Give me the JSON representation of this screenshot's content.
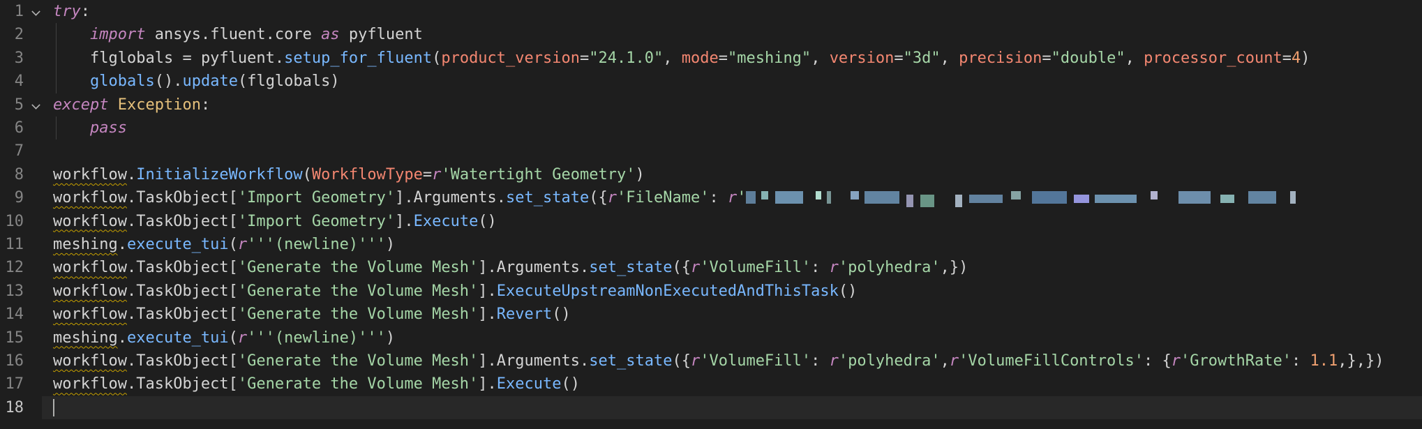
{
  "editor": {
    "language": "python",
    "current_line": 18,
    "redacted_note": "",
    "lines": [
      {
        "n": "1",
        "tokens": [
          [
            "ctrl",
            "try"
          ],
          [
            "plain",
            ":"
          ]
        ],
        "fold": true
      },
      {
        "n": "2",
        "indent": 1,
        "tokens": [
          [
            "ctrl",
            "import"
          ],
          [
            "plain",
            " ansys.fluent.core "
          ],
          [
            "ctrl",
            "as"
          ],
          [
            "plain",
            " pyfluent"
          ]
        ]
      },
      {
        "n": "3",
        "indent": 1,
        "tokens": [
          [
            "plain",
            "flglobals = pyfluent."
          ],
          [
            "meth",
            "setup_for_fluent"
          ],
          [
            "plain",
            "("
          ],
          [
            "param",
            "product_version"
          ],
          [
            "plain",
            "="
          ],
          [
            "strg",
            "\"24.1.0\""
          ],
          [
            "plain",
            ", "
          ],
          [
            "param",
            "mode"
          ],
          [
            "plain",
            "="
          ],
          [
            "strg",
            "\"meshing\""
          ],
          [
            "plain",
            ", "
          ],
          [
            "param",
            "version"
          ],
          [
            "plain",
            "="
          ],
          [
            "strg",
            "\"3d\""
          ],
          [
            "plain",
            ", "
          ],
          [
            "param",
            "precision"
          ],
          [
            "plain",
            "="
          ],
          [
            "strg",
            "\"double\""
          ],
          [
            "plain",
            ", "
          ],
          [
            "param",
            "processor_count"
          ],
          [
            "plain",
            "="
          ],
          [
            "num",
            "4"
          ],
          [
            "plain",
            ")"
          ]
        ]
      },
      {
        "n": "4",
        "indent": 1,
        "tokens": [
          [
            "meth",
            "globals"
          ],
          [
            "plain",
            "()."
          ],
          [
            "meth",
            "update"
          ],
          [
            "plain",
            "(flglobals)"
          ]
        ]
      },
      {
        "n": "5",
        "tokens": [
          [
            "ctrl",
            "except"
          ],
          [
            "plain",
            " "
          ],
          [
            "cls",
            "Exception"
          ],
          [
            "plain",
            ":"
          ]
        ],
        "fold": true
      },
      {
        "n": "6",
        "indent": 1,
        "tokens": [
          [
            "ctrl",
            "pass"
          ]
        ]
      },
      {
        "n": "7",
        "tokens": []
      },
      {
        "n": "8",
        "tokens": [
          [
            "squig",
            "workflow"
          ],
          [
            "plain",
            "."
          ],
          [
            "meth",
            "InitializeWorkflow"
          ],
          [
            "plain",
            "("
          ],
          [
            "param",
            "WorkflowType"
          ],
          [
            "plain",
            "="
          ],
          [
            "rpre",
            "r"
          ],
          [
            "strg",
            "'Watertight Geometry'"
          ],
          [
            "plain",
            ")"
          ]
        ]
      },
      {
        "n": "9",
        "tokens": [
          [
            "squig",
            "workflow"
          ],
          [
            "plain",
            ".TaskObject["
          ],
          [
            "strg",
            "'Import Geometry'"
          ],
          [
            "plain",
            "].Arguments."
          ],
          [
            "meth",
            "set_state"
          ],
          [
            "plain",
            "({"
          ],
          [
            "rpre",
            "r"
          ],
          [
            "strg",
            "'FileName'"
          ],
          [
            "plain",
            ": "
          ],
          [
            "rpre",
            "r"
          ],
          [
            "strg",
            "'"
          ],
          [
            "blur",
            ""
          ]
        ]
      },
      {
        "n": "10",
        "tokens": [
          [
            "squig",
            "workflow"
          ],
          [
            "plain",
            ".TaskObject["
          ],
          [
            "strg",
            "'Import Geometry'"
          ],
          [
            "plain",
            "]."
          ],
          [
            "meth",
            "Execute"
          ],
          [
            "plain",
            "()"
          ]
        ]
      },
      {
        "n": "11",
        "tokens": [
          [
            "squig",
            "meshing"
          ],
          [
            "plain",
            "."
          ],
          [
            "meth",
            "execute_tui"
          ],
          [
            "plain",
            "("
          ],
          [
            "rpre",
            "r"
          ],
          [
            "strg",
            "'''(newline)'''"
          ],
          [
            "plain",
            ")"
          ]
        ]
      },
      {
        "n": "12",
        "tokens": [
          [
            "squig",
            "workflow"
          ],
          [
            "plain",
            ".TaskObject["
          ],
          [
            "strg",
            "'Generate the Volume Mesh'"
          ],
          [
            "plain",
            "].Arguments."
          ],
          [
            "meth",
            "set_state"
          ],
          [
            "plain",
            "({"
          ],
          [
            "rpre",
            "r"
          ],
          [
            "strg",
            "'VolumeFill'"
          ],
          [
            "plain",
            ": "
          ],
          [
            "rpre",
            "r"
          ],
          [
            "strg",
            "'polyhedra'"
          ],
          [
            "plain",
            ",})"
          ]
        ]
      },
      {
        "n": "13",
        "tokens": [
          [
            "squig",
            "workflow"
          ],
          [
            "plain",
            ".TaskObject["
          ],
          [
            "strg",
            "'Generate the Volume Mesh'"
          ],
          [
            "plain",
            "]."
          ],
          [
            "meth",
            "ExecuteUpstreamNonExecutedAndThisTask"
          ],
          [
            "plain",
            "()"
          ]
        ]
      },
      {
        "n": "14",
        "tokens": [
          [
            "squig",
            "workflow"
          ],
          [
            "plain",
            ".TaskObject["
          ],
          [
            "strg",
            "'Generate the Volume Mesh'"
          ],
          [
            "plain",
            "]."
          ],
          [
            "meth",
            "Revert"
          ],
          [
            "plain",
            "()"
          ]
        ]
      },
      {
        "n": "15",
        "tokens": [
          [
            "squig",
            "meshing"
          ],
          [
            "plain",
            "."
          ],
          [
            "meth",
            "execute_tui"
          ],
          [
            "plain",
            "("
          ],
          [
            "rpre",
            "r"
          ],
          [
            "strg",
            "'''(newline)'''"
          ],
          [
            "plain",
            ")"
          ]
        ]
      },
      {
        "n": "16",
        "tokens": [
          [
            "squig",
            "workflow"
          ],
          [
            "plain",
            ".TaskObject["
          ],
          [
            "strg",
            "'Generate the Volume Mesh'"
          ],
          [
            "plain",
            "].Arguments."
          ],
          [
            "meth",
            "set_state"
          ],
          [
            "plain",
            "({"
          ],
          [
            "rpre",
            "r"
          ],
          [
            "strg",
            "'VolumeFill'"
          ],
          [
            "plain",
            ": "
          ],
          [
            "rpre",
            "r"
          ],
          [
            "strg",
            "'polyhedra'"
          ],
          [
            "plain",
            ","
          ],
          [
            "rpre",
            "r"
          ],
          [
            "strg",
            "'VolumeFillControls'"
          ],
          [
            "plain",
            ": {"
          ],
          [
            "rpre",
            "r"
          ],
          [
            "strg",
            "'GrowthRate'"
          ],
          [
            "plain",
            ": "
          ],
          [
            "num",
            "1.1"
          ],
          [
            "plain",
            ",},})"
          ]
        ]
      },
      {
        "n": "17",
        "tokens": [
          [
            "squig",
            "workflow"
          ],
          [
            "plain",
            ".TaskObject["
          ],
          [
            "strg",
            "'Generate the Volume Mesh'"
          ],
          [
            "plain",
            "]."
          ],
          [
            "meth",
            "Execute"
          ],
          [
            "plain",
            "()"
          ]
        ]
      },
      {
        "n": "18",
        "tokens": [],
        "current": true
      }
    ]
  },
  "colors": {
    "background": "#1e1e1e",
    "line_number": "#858585",
    "keyword": "#c586c0",
    "string": "#a5d6a7",
    "parameter": "#f48771",
    "method": "#79b8ff",
    "number": "#f0a070",
    "class": "#e5c07b",
    "warning_squiggle": "#c6a000"
  }
}
